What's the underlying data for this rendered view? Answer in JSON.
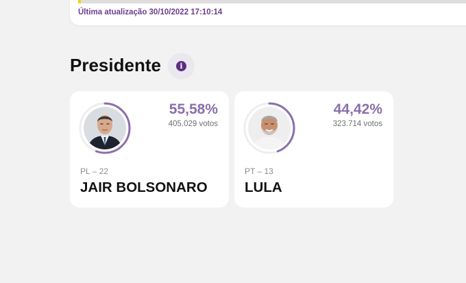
{
  "update": {
    "text": "Última atualização 30/10/2022 17:10:14",
    "progress_fraction": 0.007
  },
  "section": {
    "title": "Presidente",
    "info_icon": "info-icon"
  },
  "colors": {
    "accent": "#8a6fab",
    "brand_dark": "#5a2d82",
    "update_text": "#6b3d8f",
    "marker": "#f2d600"
  },
  "candidates": [
    {
      "percent": "55,58%",
      "percent_fraction": 0.5558,
      "votes": "405.029 votos",
      "party": "PL – 22",
      "name": "JAIR BOLSONARO"
    },
    {
      "percent": "44,42%",
      "percent_fraction": 0.4442,
      "votes": "323.714 votos",
      "party": "PT – 13",
      "name": "LULA"
    }
  ]
}
